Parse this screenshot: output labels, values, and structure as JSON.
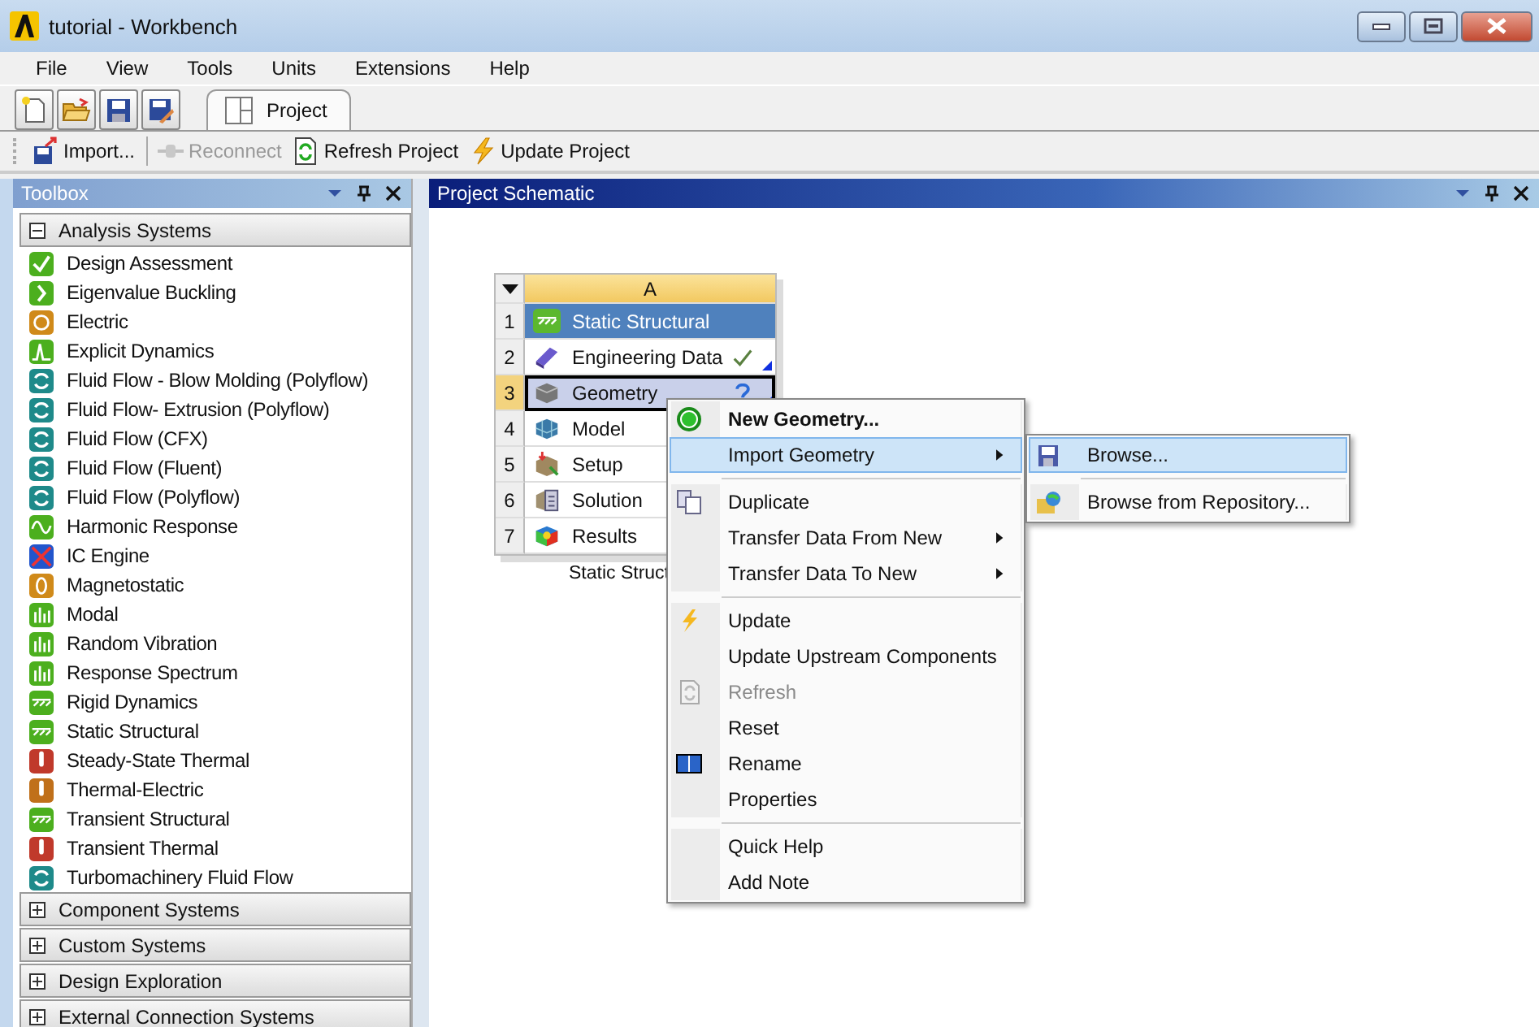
{
  "window": {
    "title": "tutorial - Workbench"
  },
  "menu": [
    "File",
    "View",
    "Tools",
    "Units",
    "Extensions",
    "Help"
  ],
  "tabs": [
    {
      "label": "Project",
      "selected": true
    }
  ],
  "toolbar": [
    {
      "label": "Import...",
      "disabled": false
    },
    {
      "label": "Reconnect",
      "disabled": true
    },
    {
      "label": "Refresh Project",
      "disabled": false
    },
    {
      "label": "Update Project",
      "disabled": false
    }
  ],
  "toolbox": {
    "title": "Toolbox",
    "groups": [
      {
        "label": "Analysis Systems",
        "expanded": true,
        "items": [
          "Design Assessment",
          "Eigenvalue Buckling",
          "Electric",
          "Explicit Dynamics",
          "Fluid Flow - Blow Molding (Polyflow)",
          "Fluid Flow- Extrusion (Polyflow)",
          "Fluid Flow (CFX)",
          "Fluid Flow (Fluent)",
          "Fluid Flow (Polyflow)",
          "Harmonic Response",
          "IC Engine",
          "Magnetostatic",
          "Modal",
          "Random Vibration",
          "Response Spectrum",
          "Rigid Dynamics",
          "Static Structural",
          "Steady-State Thermal",
          "Thermal-Electric",
          "Transient Structural",
          "Transient Thermal",
          "Turbomachinery Fluid Flow"
        ]
      },
      {
        "label": "Component Systems",
        "expanded": false
      },
      {
        "label": "Custom Systems",
        "expanded": false
      },
      {
        "label": "Design Exploration",
        "expanded": false
      },
      {
        "label": "External Connection Systems",
        "expanded": false
      }
    ]
  },
  "schematic": {
    "title": "Project Schematic",
    "column": "A",
    "caption": "Static Struct",
    "rows": [
      {
        "number": "1",
        "label": "Static Structural",
        "kind": "title",
        "up_to_date": false,
        "needs_attention": false,
        "selected": false
      },
      {
        "number": "2",
        "label": "Engineering Data",
        "kind": "cell",
        "up_to_date": true,
        "needs_attention": false,
        "selected": false
      },
      {
        "number": "3",
        "label": "Geometry",
        "kind": "cell",
        "up_to_date": false,
        "needs_attention": true,
        "selected": true
      },
      {
        "number": "4",
        "label": "Model",
        "kind": "cell",
        "up_to_date": false,
        "needs_attention": false,
        "selected": false
      },
      {
        "number": "5",
        "label": "Setup",
        "kind": "cell",
        "up_to_date": false,
        "needs_attention": false,
        "selected": false
      },
      {
        "number": "6",
        "label": "Solution",
        "kind": "cell",
        "up_to_date": false,
        "needs_attention": false,
        "selected": false
      },
      {
        "number": "7",
        "label": "Results",
        "kind": "cell",
        "up_to_date": false,
        "needs_attention": false,
        "selected": false
      }
    ]
  },
  "context_menu": {
    "groups": [
      [
        {
          "label": "New Geometry...",
          "bold": true,
          "submenu": false,
          "disabled": false,
          "selected": false
        },
        {
          "label": "Import Geometry",
          "bold": false,
          "submenu": true,
          "disabled": false,
          "selected": true
        }
      ],
      [
        {
          "label": "Duplicate",
          "bold": false,
          "submenu": false,
          "disabled": false,
          "selected": false
        },
        {
          "label": "Transfer Data From New",
          "bold": false,
          "submenu": true,
          "disabled": false,
          "selected": false
        },
        {
          "label": "Transfer Data To New",
          "bold": false,
          "submenu": true,
          "disabled": false,
          "selected": false
        }
      ],
      [
        {
          "label": "Update",
          "bold": false,
          "submenu": false,
          "disabled": false,
          "selected": false
        },
        {
          "label": "Update Upstream Components",
          "bold": false,
          "submenu": false,
          "disabled": false,
          "selected": false
        },
        {
          "label": "Refresh",
          "bold": false,
          "submenu": false,
          "disabled": true,
          "selected": false
        },
        {
          "label": "Reset",
          "bold": false,
          "submenu": false,
          "disabled": false,
          "selected": false
        },
        {
          "label": "Rename",
          "bold": false,
          "submenu": false,
          "disabled": false,
          "selected": false
        },
        {
          "label": "Properties",
          "bold": false,
          "submenu": false,
          "disabled": false,
          "selected": false
        }
      ],
      [
        {
          "label": "Quick Help",
          "bold": false,
          "submenu": false,
          "disabled": false,
          "selected": false
        },
        {
          "label": "Add Note",
          "bold": false,
          "submenu": false,
          "disabled": false,
          "selected": false
        }
      ]
    ]
  },
  "submenu": {
    "groups": [
      [
        {
          "label": "Browse...",
          "selected": true
        }
      ],
      [
        {
          "label": "Browse from Repository...",
          "selected": false
        }
      ]
    ]
  }
}
